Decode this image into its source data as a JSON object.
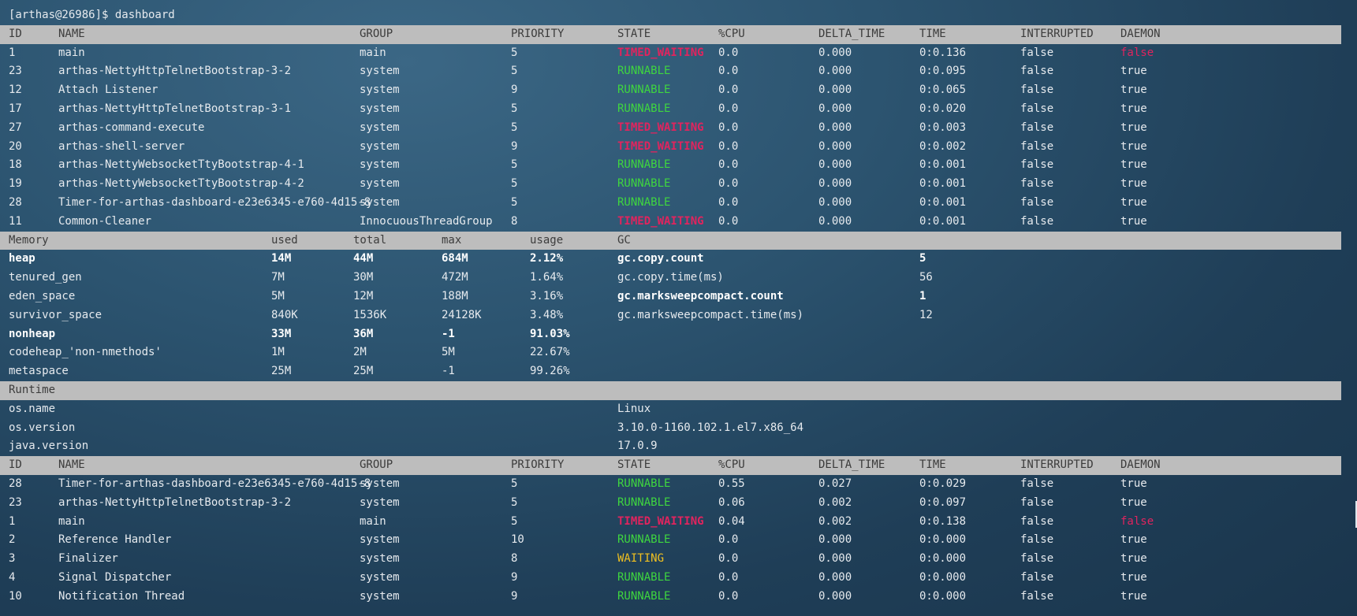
{
  "prompt": "[arthas@26986]$ dashboard",
  "thread_columns": [
    "ID",
    "NAME",
    "GROUP",
    "PRIORITY",
    "STATE",
    "%CPU",
    "DELTA_TIME",
    "TIME",
    "INTERRUPTED",
    "DAEMON"
  ],
  "threads_top": [
    {
      "id": "1",
      "name": "main",
      "group": "main",
      "priority": "5",
      "state": "TIMED_WAITING",
      "cpu": "0.0",
      "delta": "0.000",
      "time": "0:0.136",
      "interrupted": "false",
      "daemon": "false"
    },
    {
      "id": "23",
      "name": "arthas-NettyHttpTelnetBootstrap-3-2",
      "group": "system",
      "priority": "5",
      "state": "RUNNABLE",
      "cpu": "0.0",
      "delta": "0.000",
      "time": "0:0.095",
      "interrupted": "false",
      "daemon": "true"
    },
    {
      "id": "12",
      "name": "Attach Listener",
      "group": "system",
      "priority": "9",
      "state": "RUNNABLE",
      "cpu": "0.0",
      "delta": "0.000",
      "time": "0:0.065",
      "interrupted": "false",
      "daemon": "true"
    },
    {
      "id": "17",
      "name": "arthas-NettyHttpTelnetBootstrap-3-1",
      "group": "system",
      "priority": "5",
      "state": "RUNNABLE",
      "cpu": "0.0",
      "delta": "0.000",
      "time": "0:0.020",
      "interrupted": "false",
      "daemon": "true"
    },
    {
      "id": "27",
      "name": "arthas-command-execute",
      "group": "system",
      "priority": "5",
      "state": "TIMED_WAITING",
      "cpu": "0.0",
      "delta": "0.000",
      "time": "0:0.003",
      "interrupted": "false",
      "daemon": "true"
    },
    {
      "id": "20",
      "name": "arthas-shell-server",
      "group": "system",
      "priority": "9",
      "state": "TIMED_WAITING",
      "cpu": "0.0",
      "delta": "0.000",
      "time": "0:0.002",
      "interrupted": "false",
      "daemon": "true"
    },
    {
      "id": "18",
      "name": "arthas-NettyWebsocketTtyBootstrap-4-1",
      "group": "system",
      "priority": "5",
      "state": "RUNNABLE",
      "cpu": "0.0",
      "delta": "0.000",
      "time": "0:0.001",
      "interrupted": "false",
      "daemon": "true"
    },
    {
      "id": "19",
      "name": "arthas-NettyWebsocketTtyBootstrap-4-2",
      "group": "system",
      "priority": "5",
      "state": "RUNNABLE",
      "cpu": "0.0",
      "delta": "0.000",
      "time": "0:0.001",
      "interrupted": "false",
      "daemon": "true"
    },
    {
      "id": "28",
      "name": "Timer-for-arthas-dashboard-e23e6345-e760-4d15-8",
      "group": "system",
      "priority": "5",
      "state": "RUNNABLE",
      "cpu": "0.0",
      "delta": "0.000",
      "time": "0:0.001",
      "interrupted": "false",
      "daemon": "true"
    },
    {
      "id": "11",
      "name": "Common-Cleaner",
      "group": "InnocuousThreadGroup",
      "priority": "8",
      "state": "TIMED_WAITING",
      "cpu": "0.0",
      "delta": "0.000",
      "time": "0:0.001",
      "interrupted": "false",
      "daemon": "true"
    }
  ],
  "memory_columns": [
    "Memory",
    "used",
    "total",
    "max",
    "usage",
    "GC"
  ],
  "memory_rows": [
    {
      "name": "heap",
      "used": "14M",
      "total": "44M",
      "max": "684M",
      "usage": "2.12%",
      "bold": true
    },
    {
      "name": "tenured_gen",
      "used": "7M",
      "total": "30M",
      "max": "472M",
      "usage": "1.64%",
      "bold": false
    },
    {
      "name": "eden_space",
      "used": "5M",
      "total": "12M",
      "max": "188M",
      "usage": "3.16%",
      "bold": false
    },
    {
      "name": "survivor_space",
      "used": "840K",
      "total": "1536K",
      "max": "24128K",
      "usage": "3.48%",
      "bold": false
    },
    {
      "name": "nonheap",
      "used": "33M",
      "total": "36M",
      "max": "-1",
      "usage": "91.03%",
      "bold": true
    },
    {
      "name": "codeheap_'non-nmethods'",
      "used": "1M",
      "total": "2M",
      "max": "5M",
      "usage": "22.67%",
      "bold": false
    },
    {
      "name": "metaspace",
      "used": "25M",
      "total": "25M",
      "max": "-1",
      "usage": "99.26%",
      "bold": false
    }
  ],
  "gc_rows": [
    {
      "name": "gc.copy.count",
      "value": "5",
      "bold": true
    },
    {
      "name": "gc.copy.time(ms)",
      "value": "56",
      "bold": false
    },
    {
      "name": "gc.marksweepcompact.count",
      "value": "1",
      "bold": true
    },
    {
      "name": "gc.marksweepcompact.time(ms)",
      "value": "12",
      "bold": false
    }
  ],
  "runtime_header": "Runtime",
  "runtime_rows": [
    {
      "name": "os.name",
      "value": "Linux"
    },
    {
      "name": "os.version",
      "value": "3.10.0-1160.102.1.el7.x86_64"
    },
    {
      "name": "java.version",
      "value": "17.0.9"
    }
  ],
  "threads_bottom": [
    {
      "id": "28",
      "name": "Timer-for-arthas-dashboard-e23e6345-e760-4d15-8",
      "group": "system",
      "priority": "5",
      "state": "RUNNABLE",
      "cpu": "0.55",
      "delta": "0.027",
      "time": "0:0.029",
      "interrupted": "false",
      "daemon": "true"
    },
    {
      "id": "23",
      "name": "arthas-NettyHttpTelnetBootstrap-3-2",
      "group": "system",
      "priority": "5",
      "state": "RUNNABLE",
      "cpu": "0.06",
      "delta": "0.002",
      "time": "0:0.097",
      "interrupted": "false",
      "daemon": "true"
    },
    {
      "id": "1",
      "name": "main",
      "group": "main",
      "priority": "5",
      "state": "TIMED_WAITING",
      "cpu": "0.04",
      "delta": "0.002",
      "time": "0:0.138",
      "interrupted": "false",
      "daemon": "false"
    },
    {
      "id": "2",
      "name": "Reference Handler",
      "group": "system",
      "priority": "10",
      "state": "RUNNABLE",
      "cpu": "0.0",
      "delta": "0.000",
      "time": "0:0.000",
      "interrupted": "false",
      "daemon": "true"
    },
    {
      "id": "3",
      "name": "Finalizer",
      "group": "system",
      "priority": "8",
      "state": "WAITING",
      "cpu": "0.0",
      "delta": "0.000",
      "time": "0:0.000",
      "interrupted": "false",
      "daemon": "true"
    },
    {
      "id": "4",
      "name": "Signal Dispatcher",
      "group": "system",
      "priority": "9",
      "state": "RUNNABLE",
      "cpu": "0.0",
      "delta": "0.000",
      "time": "0:0.000",
      "interrupted": "false",
      "daemon": "true"
    },
    {
      "id": "10",
      "name": "Notification Thread",
      "group": "system",
      "priority": "9",
      "state": "RUNNABLE",
      "cpu": "0.0",
      "delta": "0.000",
      "time": "0:0.000",
      "interrupted": "false",
      "daemon": "true"
    }
  ],
  "colors": {
    "timed_waiting": "#e0245e",
    "runnable": "#3fd63f",
    "waiting": "#f0c020",
    "header_bg": "#bdbdbd"
  }
}
